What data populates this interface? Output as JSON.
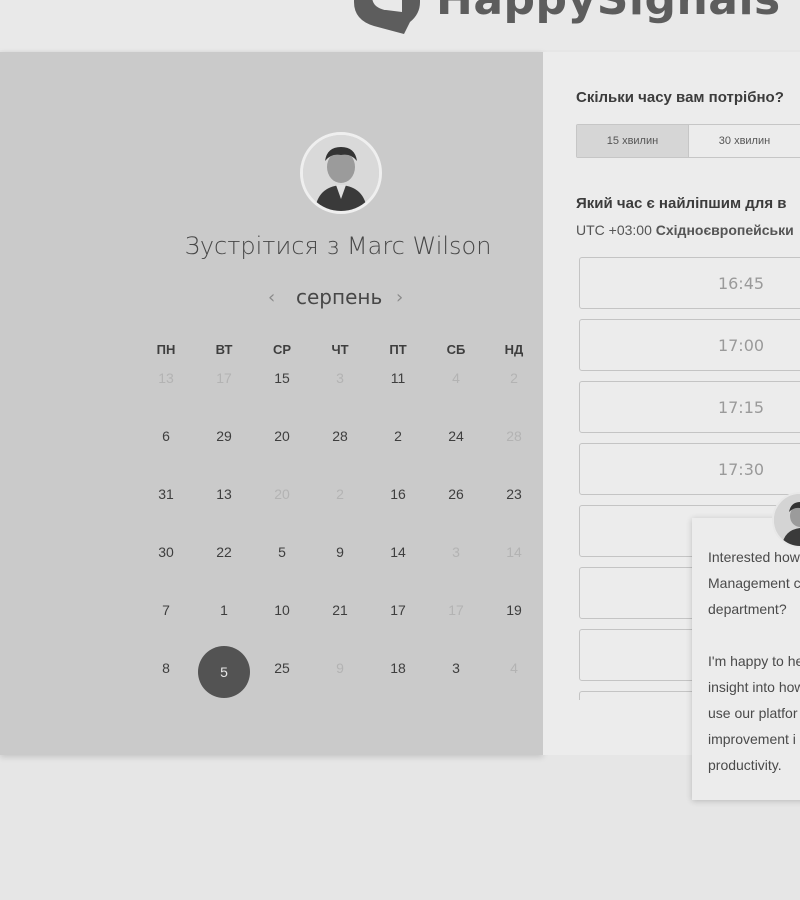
{
  "header": {
    "brand": "HappySignals"
  },
  "scheduler": {
    "meet_title": "Зустрітися з Marc Wilson",
    "month": "серпень",
    "prev_icon": "chevron-left-icon",
    "next_icon": "chevron-right-icon",
    "weekdays": [
      "ПН",
      "ВТ",
      "СР",
      "ЧТ",
      "ПТ",
      "СБ",
      "НД"
    ],
    "weeks": [
      [
        {
          "d": "13",
          "m": true
        },
        {
          "d": "17",
          "m": true
        },
        {
          "d": "15",
          "m": false
        },
        {
          "d": "3",
          "m": true
        },
        {
          "d": "11",
          "m": false
        },
        {
          "d": "4",
          "m": true
        },
        {
          "d": "2",
          "m": true
        }
      ],
      [
        {
          "d": "6",
          "m": false
        },
        {
          "d": "29",
          "m": false
        },
        {
          "d": "20",
          "m": false
        },
        {
          "d": "28",
          "m": false
        },
        {
          "d": "2",
          "m": false
        },
        {
          "d": "24",
          "m": false
        },
        {
          "d": "28",
          "m": true
        }
      ],
      [
        {
          "d": "31",
          "m": false
        },
        {
          "d": "13",
          "m": false
        },
        {
          "d": "20",
          "m": true
        },
        {
          "d": "2",
          "m": true
        },
        {
          "d": "16",
          "m": false
        },
        {
          "d": "26",
          "m": false
        },
        {
          "d": "23",
          "m": false
        }
      ],
      [
        {
          "d": "30",
          "m": false
        },
        {
          "d": "22",
          "m": false
        },
        {
          "d": "5",
          "m": false
        },
        {
          "d": "9",
          "m": false
        },
        {
          "d": "14",
          "m": false
        },
        {
          "d": "3",
          "m": true
        },
        {
          "d": "14",
          "m": true
        }
      ],
      [
        {
          "d": "7",
          "m": false
        },
        {
          "d": "1",
          "m": false
        },
        {
          "d": "10",
          "m": false
        },
        {
          "d": "21",
          "m": false
        },
        {
          "d": "17",
          "m": false
        },
        {
          "d": "17",
          "m": true
        },
        {
          "d": "19",
          "m": false
        }
      ],
      [
        {
          "d": "8",
          "m": false
        },
        {
          "d": "5",
          "m": false,
          "sel": true
        },
        {
          "d": "25",
          "m": false
        },
        {
          "d": "9",
          "m": true
        },
        {
          "d": "18",
          "m": false
        },
        {
          "d": "3",
          "m": false
        },
        {
          "d": "4",
          "m": true
        }
      ]
    ]
  },
  "booking": {
    "duration_question": "Скільки часу вам потрібно?",
    "durations": [
      "15 хвилин",
      "30 хвилин"
    ],
    "time_question": "Який час є найліпшим для в",
    "timezone_prefix": "UTC +03:00 ",
    "timezone_name": "Східноєвропейськи",
    "slots": [
      "16:45",
      "17:00",
      "17:15",
      "17:30",
      "",
      "",
      "",
      ""
    ]
  },
  "chat": {
    "message": "Interested how\nManagement c\ndepartment?\n\nI'm happy to he\ninsight into how\nuse our platfor\nimprovement i\nproductivity."
  },
  "colors": {
    "selected_day": "#535353",
    "left_panel": "#cacaca",
    "right_panel": "#ececec"
  }
}
